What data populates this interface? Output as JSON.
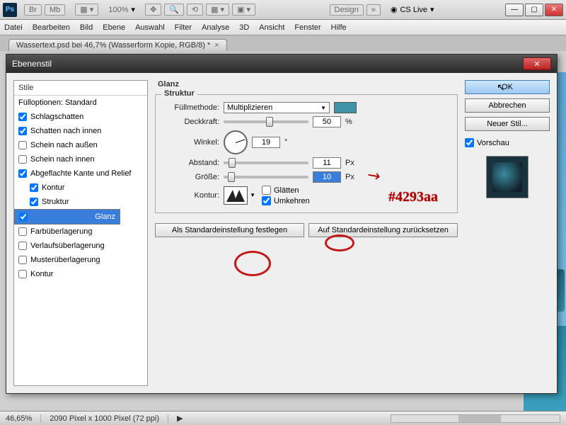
{
  "app": {
    "logo": "Ps",
    "zoom": "100%",
    "design_btn": "Design",
    "cslive": "CS Live"
  },
  "menu": [
    "Datei",
    "Bearbeiten",
    "Bild",
    "Ebene",
    "Auswahl",
    "Filter",
    "Analyse",
    "3D",
    "Ansicht",
    "Fenster",
    "Hilfe"
  ],
  "doc_tab": "Wassertext.psd bei 46,7% (Wasserform Kopie, RGB/8) *",
  "dialog": {
    "title": "Ebenenstil",
    "styles_header": "Stile",
    "blend_options": "Fülloptionen: Standard",
    "effects": [
      {
        "label": "Schlagschatten",
        "checked": true,
        "indent": false
      },
      {
        "label": "Schatten nach innen",
        "checked": true,
        "indent": false
      },
      {
        "label": "Schein nach außen",
        "checked": false,
        "indent": false
      },
      {
        "label": "Schein nach innen",
        "checked": false,
        "indent": false
      },
      {
        "label": "Abgeflachte Kante und Relief",
        "checked": true,
        "indent": false
      },
      {
        "label": "Kontur",
        "checked": true,
        "indent": true
      },
      {
        "label": "Struktur",
        "checked": true,
        "indent": true
      },
      {
        "label": "Glanz",
        "checked": true,
        "indent": false,
        "selected": true
      },
      {
        "label": "Farbüberlagerung",
        "checked": false,
        "indent": false
      },
      {
        "label": "Verlaufsüberlagerung",
        "checked": false,
        "indent": false
      },
      {
        "label": "Musterüberlagerung",
        "checked": false,
        "indent": false
      },
      {
        "label": "Kontur",
        "checked": false,
        "indent": false
      }
    ],
    "section_title": "Glanz",
    "subsection_title": "Struktur",
    "blend_mode_label": "Füllmethode:",
    "blend_mode_value": "Multiplizieren",
    "color_hex": "#4293aa",
    "opacity_label": "Deckkraft:",
    "opacity_value": "50",
    "opacity_unit": "%",
    "angle_label": "Winkel:",
    "angle_value": "19",
    "angle_unit": "°",
    "distance_label": "Abstand:",
    "distance_value": "11",
    "distance_unit": "Px",
    "size_label": "Größe:",
    "size_value": "10",
    "size_unit": "Px",
    "contour_label": "Kontur:",
    "anti_alias": "Glätten",
    "invert": "Umkehren",
    "make_default": "Als Standardeinstellung festlegen",
    "reset_default": "Auf Standardeinstellung zurücksetzen",
    "ok": "OK",
    "cancel": "Abbrechen",
    "new_style": "Neuer Stil...",
    "preview_label": "Vorschau",
    "preview_checked": true
  },
  "annotation": "#4293aa",
  "status": {
    "zoom": "46,65%",
    "dims": "2090 Pixel x 1000 Pixel (72 ppi)"
  }
}
